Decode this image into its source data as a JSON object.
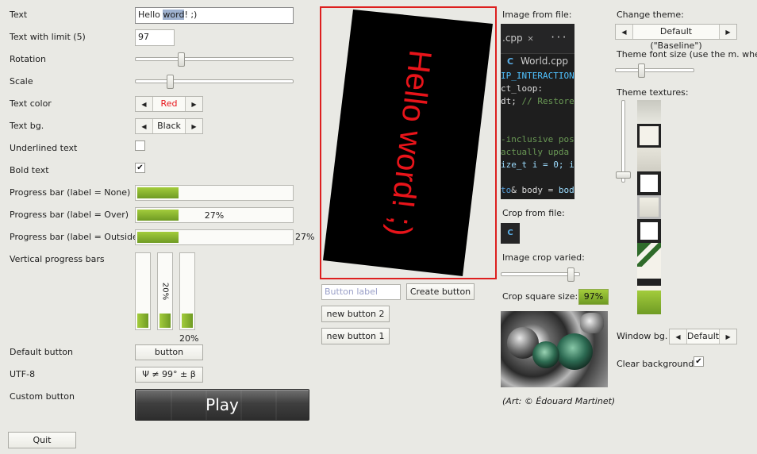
{
  "rows": {
    "text_label": "Text",
    "text_value_pre": "Hello ",
    "text_value_sel": "word",
    "text_value_post": "! ;)",
    "limit_label": "Text with limit (5)",
    "limit_value": "97",
    "rotation_label": "Rotation",
    "rotation_level": 0.29,
    "scale_label": "Scale",
    "scale_level": 0.22,
    "textcolor_label": "Text color",
    "textcolor_value": "Red",
    "textbg_label": "Text bg.",
    "textbg_value": "Black",
    "underlined_label": "Underlined text",
    "underlined_checked": false,
    "bold_label": "Bold text",
    "bold_checked": true,
    "check_mark": "✔",
    "pb_none_label": "Progress bar (label = None)",
    "pb_over_label": "Progress bar (label = Over)",
    "pb_outside_label": "Progress bar (label = Outside)",
    "progress_value": 0.27,
    "progress_text": "27%",
    "vbars_label": "Vertical progress bars",
    "vbar_value": 0.2,
    "vbar_text": "20%",
    "default_button_label": "Default button",
    "default_button_text": "button",
    "utf8_label": "UTF-8",
    "utf8_button_text": "Ψ ≠ 99° ± β",
    "custom_button_label": "Custom button",
    "play_text": "Play",
    "quit_text": "Quit"
  },
  "preview": {
    "text": "Hello word! ;)",
    "text_color": "#e8141a",
    "bg_color": "#000000",
    "border_color": "#dd1f1f"
  },
  "middle": {
    "button_label_placeholder": "Button label",
    "create_button": "Create button",
    "new_button_2": "new button 2",
    "new_button_1": "new button 1"
  },
  "images": {
    "image_from_file_label": "Image from file:",
    "code_tab_name": ".cpp",
    "code_tab_close": "✕",
    "code_tab_more": "···",
    "code_file_name": "World.cpp",
    "code_lines": [
      "IP_INTERACTION",
      "ct_loop:",
      "dt; // Restore",
      "",
      "",
      "-inclusive pos",
      " actually upda",
      "ize_t i = 0; i",
      "",
      "to& body = bod"
    ],
    "crop_from_file_label": "Crop from file:",
    "image_crop_varied_label": "Image crop varied:",
    "crop_varied_level": 0.88,
    "crop_square_label": "Crop square size:",
    "crop_square_value": "97%",
    "art_credit": "(Art: © Édouard Martinet)"
  },
  "theme": {
    "change_theme_label": "Change theme:",
    "theme_value": "Default (\"Baseline\")",
    "font_size_label": "Theme font size (use the m. wheel):",
    "font_size_level": 0.33,
    "textures_label": "Theme textures:",
    "textures_scroll_level": 0.95,
    "window_bg_label": "Window bg.",
    "window_bg_value": "Default",
    "clear_bg_label": "Clear background",
    "clear_bg_checked": true
  },
  "colors": {
    "progress_green": "#8ab82f",
    "accent_red": "#dd1f1f",
    "window_bg": "#e9e9e4"
  }
}
